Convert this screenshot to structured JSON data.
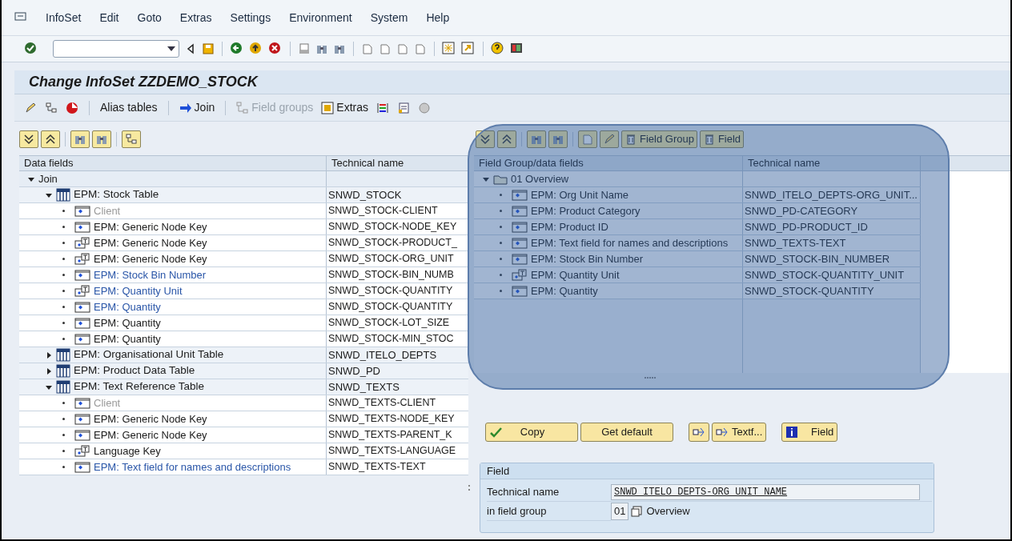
{
  "menu": [
    "InfoSet",
    "Edit",
    "Goto",
    "Extras",
    "Settings",
    "Environment",
    "System",
    "Help"
  ],
  "title": "Change InfoSet ZZDEMO_STOCK",
  "app_toolbar": [
    {
      "kind": "text",
      "label": "Alias tables",
      "disabled": false
    },
    {
      "kind": "arrow",
      "label": "Join",
      "disabled": false
    },
    {
      "kind": "groups",
      "label": "Field groups",
      "disabled": true
    },
    {
      "kind": "extras",
      "label": "Extras",
      "disabled": false
    }
  ],
  "data_fields": {
    "columns": [
      "Data fields",
      "Technical name"
    ],
    "root": {
      "label": "Join",
      "expanded": true,
      "children": [
        {
          "label": "EPM: Stock Table",
          "technical_name": "SNWD_STOCK",
          "expanded": true,
          "children": [
            {
              "kind": "field",
              "label": "Client",
              "technical_name": "SNWD_STOCK-CLIENT",
              "disabled": true,
              "assigned": false
            },
            {
              "kind": "field",
              "label": "EPM: Generic Node Key",
              "technical_name": "SNWD_STOCK-NODE_KEY",
              "disabled": false,
              "assigned": false
            },
            {
              "kind": "text-field",
              "label": "EPM: Generic Node Key",
              "technical_name": "SNWD_STOCK-PRODUCT_",
              "disabled": false,
              "assigned": false
            },
            {
              "kind": "text-field",
              "label": "EPM: Generic Node Key",
              "technical_name": "SNWD_STOCK-ORG_UNIT",
              "disabled": false,
              "assigned": false
            },
            {
              "kind": "field",
              "label": "EPM: Stock Bin Number",
              "technical_name": "SNWD_STOCK-BIN_NUMB",
              "disabled": false,
              "assigned": true
            },
            {
              "kind": "text-field",
              "label": "EPM: Quantity Unit",
              "technical_name": "SNWD_STOCK-QUANTITY",
              "disabled": false,
              "assigned": true
            },
            {
              "kind": "field",
              "label": "EPM: Quantity",
              "technical_name": "SNWD_STOCK-QUANTITY",
              "disabled": false,
              "assigned": true
            },
            {
              "kind": "field",
              "label": "EPM: Quantity",
              "technical_name": "SNWD_STOCK-LOT_SIZE",
              "disabled": false,
              "assigned": false
            },
            {
              "kind": "field",
              "label": "EPM: Quantity",
              "technical_name": "SNWD_STOCK-MIN_STOC",
              "disabled": false,
              "assigned": false
            }
          ]
        },
        {
          "label": "EPM: Organisational Unit Table",
          "technical_name": "SNWD_ITELO_DEPTS",
          "expanded": false
        },
        {
          "label": "EPM: Product Data Table",
          "technical_name": "SNWD_PD",
          "expanded": false
        },
        {
          "label": "EPM: Text Reference Table",
          "technical_name": "SNWD_TEXTS",
          "expanded": true,
          "children": [
            {
              "kind": "field",
              "label": "Client",
              "technical_name": "SNWD_TEXTS-CLIENT",
              "disabled": true,
              "assigned": false
            },
            {
              "kind": "field",
              "label": "EPM: Generic Node Key",
              "technical_name": "SNWD_TEXTS-NODE_KEY",
              "disabled": false,
              "assigned": false
            },
            {
              "kind": "field",
              "label": "EPM: Generic Node Key",
              "technical_name": "SNWD_TEXTS-PARENT_K",
              "disabled": false,
              "assigned": false
            },
            {
              "kind": "text-field",
              "label": "Language Key",
              "technical_name": "SNWD_TEXTS-LANGUAGE",
              "disabled": false,
              "assigned": false
            },
            {
              "kind": "field",
              "label": "EPM: Text field for names and descriptions",
              "technical_name": "SNWD_TEXTS-TEXT",
              "disabled": false,
              "assigned": true
            }
          ]
        }
      ]
    }
  },
  "field_groups": {
    "toolbar_buttons": [
      "Field Group",
      "Field"
    ],
    "columns": [
      "Field Group/data fields",
      "Technical name"
    ],
    "groups": [
      {
        "label": "01 Overview",
        "expanded": true,
        "children": [
          {
            "kind": "field",
            "label": "EPM: Org Unit Name",
            "technical_name": "SNWD_ITELO_DEPTS-ORG_UNIT..."
          },
          {
            "kind": "field",
            "label": "EPM: Product Category",
            "technical_name": "SNWD_PD-CATEGORY"
          },
          {
            "kind": "field",
            "label": "EPM: Product ID",
            "technical_name": "SNWD_PD-PRODUCT_ID"
          },
          {
            "kind": "field",
            "label": "EPM: Text field for names and descriptions",
            "technical_name": "SNWD_TEXTS-TEXT"
          },
          {
            "kind": "field",
            "label": "EPM: Stock Bin Number",
            "technical_name": "SNWD_STOCK-BIN_NUMBER"
          },
          {
            "kind": "text-field",
            "label": "EPM: Quantity Unit",
            "technical_name": "SNWD_STOCK-QUANTITY_UNIT"
          },
          {
            "kind": "field",
            "label": "EPM: Quantity",
            "technical_name": "SNWD_STOCK-QUANTITY"
          }
        ]
      }
    ]
  },
  "actions": [
    {
      "kind": "check",
      "label": "Copy"
    },
    {
      "kind": "plain",
      "label": "Get default"
    },
    {
      "kind": "move"
    },
    {
      "kind": "move",
      "label": "Textf..."
    },
    {
      "kind": "info",
      "label": "Field"
    }
  ],
  "field_box": {
    "title": "Field",
    "technical_name_label": "Technical name",
    "technical_name": "SNWD_ITELO_DEPTS-ORG_UNIT_NAME",
    "group_label": "in field group",
    "group_number": "01",
    "group_name": "Overview"
  }
}
